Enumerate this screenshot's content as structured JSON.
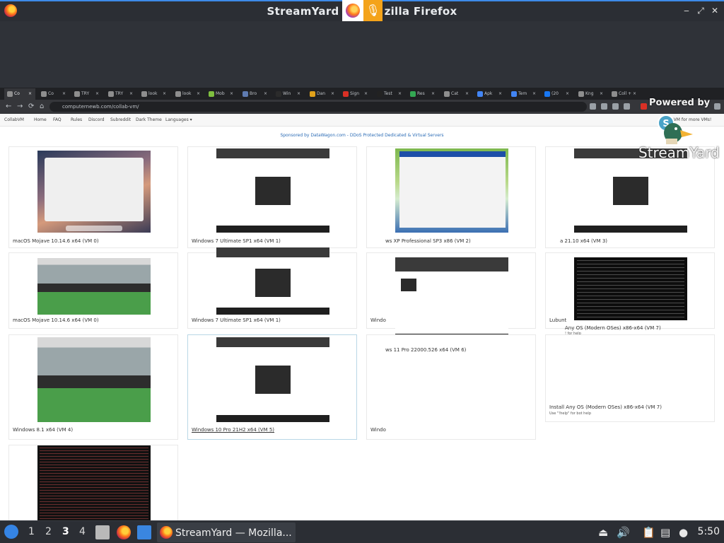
{
  "window": {
    "title": "StreamYard — Mozilla Firefox",
    "title_shown": "StreamYard",
    "title_tail": "zilla Firefox",
    "controls": [
      "‒",
      "⤢",
      "✕"
    ]
  },
  "chrome": {
    "tabs": [
      {
        "label": "Co",
        "fav": "#8e8e8e"
      },
      {
        "label": "Co",
        "fav": "#8e8e8e"
      },
      {
        "label": "TRY",
        "fav": "#8e8e8e"
      },
      {
        "label": "TRY",
        "fav": "#8e8e8e"
      },
      {
        "label": "look",
        "fav": "#8e8e8e"
      },
      {
        "label": "look",
        "fav": "#8e8e8e"
      },
      {
        "label": "Mob",
        "fav": "#7fbf3f"
      },
      {
        "label": "Bro",
        "fav": "#5f7bb0"
      },
      {
        "label": "Win",
        "fav": "#2b2b2b"
      },
      {
        "label": "Dan",
        "fav": "#e0a11a"
      },
      {
        "label": "Sign",
        "fav": "#d93025"
      },
      {
        "label": "Test",
        "fav": "#222"
      },
      {
        "label": "Res",
        "fav": "#34a853"
      },
      {
        "label": "Cat",
        "fav": "#8e8e8e"
      },
      {
        "label": "Apk",
        "fav": "#4285f4"
      },
      {
        "label": "Tem",
        "fav": "#4285f4"
      },
      {
        "label": "(20",
        "fav": "#1877f2"
      },
      {
        "label": "Kng",
        "fav": "#8e8e8e"
      },
      {
        "label": "Coll",
        "fav": "#8e8e8e"
      }
    ],
    "url": "computernewb.com/collab-vm/"
  },
  "site": {
    "nav": [
      "CollabVM",
      "Home",
      "FAQ",
      "Rules",
      "Discord",
      "Subreddit",
      "Dark Theme",
      "Languages ▾"
    ],
    "sponsor": "Sponsored by DataWagon.com - DDoS Protected Dedicated & Virtual Servers",
    "header_tail": "CollabVM for more VMs!"
  },
  "vms": [
    {
      "label": "macOS Mojave 10.14.6 x64 (VM 0)"
    },
    {
      "label": "Windows 7 Ultimate SP1 x64 (VM 1)"
    },
    {
      "label": "ws XP Professional SP3 x86 (VM 2)"
    },
    {
      "label": "a 21.10 x64 (VM 3)"
    },
    {
      "label": "macOS Mojave 10.14.6 x64 (VM 0)"
    },
    {
      "label": "Windows 7 Ultimate SP1 x64 (VM 1)"
    },
    {
      "label": "Windo"
    },
    {
      "label": "Lubunt"
    },
    {
      "label": "Any OS (Modern OSes) x86-x64 (VM 7)",
      "sub": "! for help"
    },
    {
      "label": "Windows 8.1 x64 (VM 4)"
    },
    {
      "label": "Windows 10 Pro 21H2 x64 (VM 5)"
    },
    {
      "label": "ws 11 Pro 22000.526 x64 (VM 6)"
    },
    {
      "label": "Windo"
    },
    {
      "label": "Install Any OS (Modern OSes) x86-x64 (VM 7)",
      "sub": "Use \"!help\" for bot help"
    }
  ],
  "streamyard": {
    "powered": "Powered by",
    "name": "StreamYard"
  },
  "taskbar": {
    "workspaces": [
      "1",
      "2",
      "3",
      "4"
    ],
    "active_workspace": "3",
    "task_label": "StreamYard — Mozilla...",
    "clock": "5:50"
  }
}
